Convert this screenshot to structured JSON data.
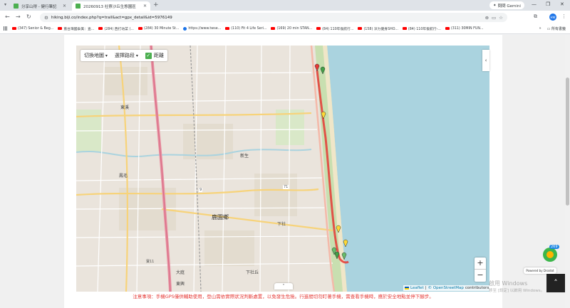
{
  "browser": {
    "tabs": [
      {
        "title": "分享山得 - 健行筆記",
        "active": false
      },
      {
        "title": "20260913 社寮沙丘生態園區",
        "active": true
      }
    ],
    "new_tab": "+",
    "gemini_label": "問問 Gemini",
    "url": "hiking.biji.co/index.php?q=trail&act=gpx_detail&id=5976149",
    "profile_initials": "HW",
    "bookmarks": [
      "(347) Senior & Beg...",
      "蓋台灣國泰美：查...",
      "(284) 西打坊菜 (...",
      "(284) 30 Minute St...",
      "https://www.twse...",
      "(110) Fit 4 Life Seri...",
      "(169) 20 min STAN...",
      "(84) 110年復航行...",
      "(158) 深力健身SHO...",
      "(84) 110年復航行-...",
      "(311) 30MIN FUN..."
    ],
    "bookmarks_all": "所有書籤"
  },
  "map": {
    "switch_map_label": "切換地圖",
    "select_route_label": "選擇路段",
    "distance_label": "距離",
    "zoom_in": "+",
    "zoom_out": "−",
    "attribution_leaflet": "Leaflet",
    "attribution_osm": "© OpenStreetMap",
    "attribution_contributors": "contributors",
    "labels": {
      "town": "鹿園鄉",
      "road_num_9": "9",
      "road_num_71": "71",
      "village_1": "鳳毛",
      "village_2": "新生",
      "village_3": "下社",
      "village_4": "大庭",
      "village_5": "東興",
      "village_6": "寶11",
      "village_7": "下社丘",
      "village_8": "東溪"
    }
  },
  "notice": "注意事項：手機GPS僅供輔助使用，登山需依實際狀況判斷處置，以免發生危險。行進間切勿盯著手機，需查看手機時，應於安全地點並停下腳步。",
  "widget": {
    "badge_count": "269",
    "powered_by": "Powered by Droidot"
  },
  "watermark": {
    "line1": "啟用 Windows",
    "line2": "移至 [設定] 以啟用 Windows。"
  }
}
